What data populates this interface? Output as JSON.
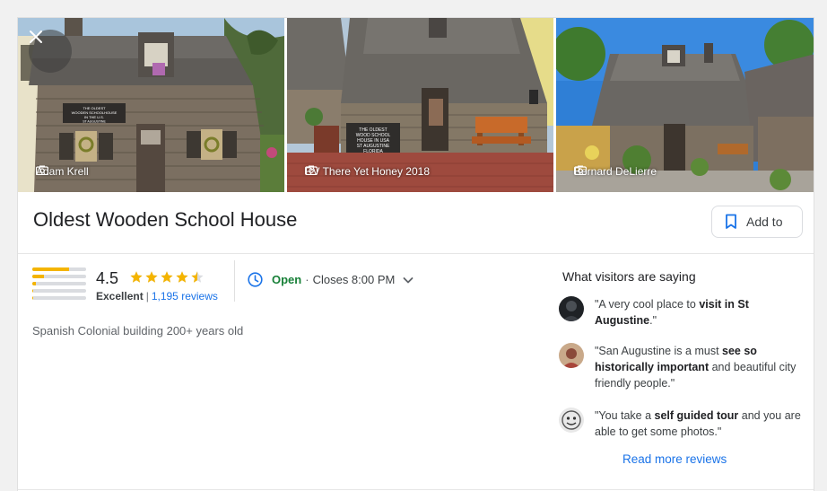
{
  "photos": [
    {
      "credit": "Adam Krell",
      "sign_lines": [
        "THE OLDEST",
        "WOODEN SCHOOLHOUSE",
        "IN THE U.S.",
        "ST AUGUSTINE"
      ]
    },
    {
      "credit": "RV There Yet Honey 2018",
      "sign_lines": [
        "THE OLDEST",
        "WOOD SCHOOL",
        "HOUSE IN USA",
        "ST AUGUSTINE",
        "FLORIDA"
      ]
    },
    {
      "credit": "Bernard DeLierre"
    }
  ],
  "place": {
    "title": "Oldest Wooden School House",
    "add_label": "Add to",
    "rating": "4.5",
    "rating_value": 4.5,
    "rating_label": "Excellent",
    "reviews_count": "1,195 reviews",
    "rating_distribution": [
      0.68,
      0.22,
      0.06,
      0.02,
      0.02
    ],
    "status": "Open",
    "closes": "Closes 8:00 PM",
    "description": "Spanish Colonial building 200+ years old"
  },
  "visitors": {
    "heading": "What visitors are saying",
    "quotes": [
      {
        "pre": "\"A very cool place to ",
        "bold": "visit in St Augustine",
        "post": ".\""
      },
      {
        "pre": "\"San Augustine is a must ",
        "bold": "see so historically important",
        "post": " and beautiful city friendly people.\""
      },
      {
        "pre": "\"You take a ",
        "bold": "self guided tour",
        "post": " and you are able to get some photos.\""
      }
    ],
    "read_more": "Read more reviews"
  },
  "colors": {
    "accent_blue": "#1a73e8",
    "open_green": "#188038",
    "star_yellow": "#f4b400"
  }
}
